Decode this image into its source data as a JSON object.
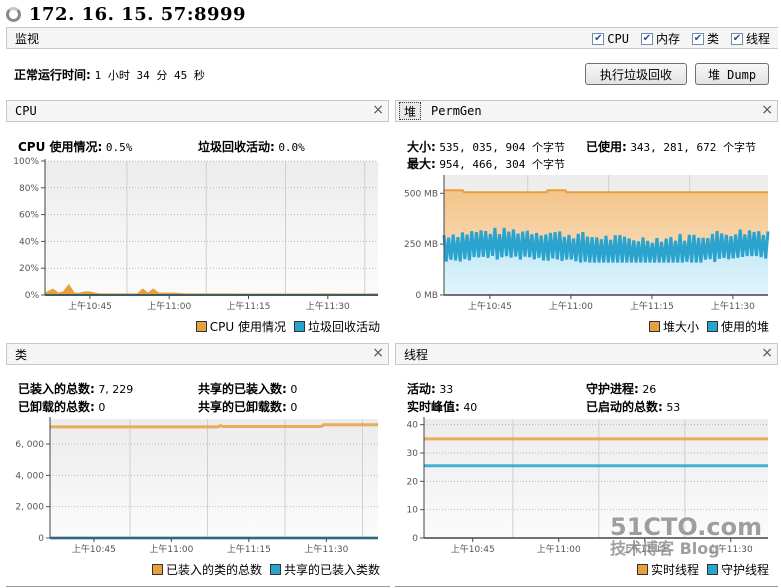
{
  "window": {
    "title": "172. 16. 15. 57:8999",
    "status_icon": "loading-spinner-icon"
  },
  "monitor_bar": {
    "label": "监视",
    "checkboxes": [
      {
        "label": "CPU",
        "checked": true
      },
      {
        "label": "内存",
        "checked": true
      },
      {
        "label": "类",
        "checked": true
      },
      {
        "label": "线程",
        "checked": true
      }
    ]
  },
  "uptime": {
    "label": "正常运行时间:",
    "value": "1 小时 34 分 45 秒"
  },
  "buttons": {
    "gc": "执行垃圾回收",
    "heap_dump": "堆 Dump"
  },
  "colors": {
    "orange": "#e8a03c",
    "blue": "#2aa3cf",
    "panel_bg": "#f5f5f5"
  },
  "cpu_panel": {
    "title": "CPU",
    "close": "×",
    "stats": [
      {
        "label": "CPU 使用情况:",
        "value": "0.5%"
      },
      {
        "label": "垃圾回收活动:",
        "value": "0.0%"
      }
    ],
    "legend": [
      "CPU 使用情况",
      "垃圾回收活动"
    ]
  },
  "memory_panel": {
    "tabs": [
      "堆",
      "PermGen"
    ],
    "active_tab": "堆",
    "close": "×",
    "stats": [
      {
        "label": "大小:",
        "value": "535, 035, 904 个字节"
      },
      {
        "label": "已使用:",
        "value": "343, 281, 672 个字节"
      },
      {
        "label": "最大:",
        "value": "954, 466, 304 个字节"
      }
    ],
    "legend": [
      "堆大小",
      "使用的堆"
    ]
  },
  "classes_panel": {
    "title": "类",
    "close": "×",
    "stats": [
      {
        "label": "已装入的总数:",
        "value": "7, 229"
      },
      {
        "label": "共享的已装入数:",
        "value": "0"
      },
      {
        "label": "已卸载的总数:",
        "value": "0"
      },
      {
        "label": "共享的已卸载数:",
        "value": "0"
      }
    ],
    "legend": [
      "已装入的类的总数",
      "共享的已装入类数"
    ]
  },
  "threads_panel": {
    "title": "线程",
    "close": "×",
    "stats": [
      {
        "label": "活动:",
        "value": "33"
      },
      {
        "label": "守护进程:",
        "value": "26"
      },
      {
        "label": "实时峰值:",
        "value": "40"
      },
      {
        "label": "已启动的总数:",
        "value": "53"
      }
    ],
    "legend": [
      "实时线程",
      "守护线程"
    ]
  },
  "watermark": {
    "main": "51CTO.com",
    "sub": "技术博客 Blog"
  },
  "chart_data": [
    {
      "id": "cpu",
      "type": "area",
      "title": "CPU",
      "x_ticks": [
        "上午10:45",
        "上午11:00",
        "上午11:15",
        "上午11:30"
      ],
      "x_range_minutes": [
        36.5,
        99.5
      ],
      "x_tick_minutes": [
        45,
        60,
        75,
        90
      ],
      "y_ticks": [
        "0%",
        "20%",
        "40%",
        "60%",
        "80%",
        "100%"
      ],
      "ylim": [
        0,
        100
      ],
      "grid": true,
      "legend": "bottom-right",
      "series": [
        {
          "name": "CPU 使用情况",
          "color": "#e8a03c",
          "x": [
            36.5,
            37,
            38,
            39,
            40,
            41,
            42,
            43,
            44,
            45,
            46,
            47,
            48,
            50,
            52,
            54,
            55,
            56,
            57,
            58,
            59,
            60,
            61,
            62,
            63,
            65,
            70,
            75,
            80,
            85,
            90,
            95,
            99.5
          ],
          "y": [
            0.5,
            2,
            4,
            1,
            2,
            7,
            1,
            1,
            2,
            2,
            1,
            0.5,
            0.5,
            0.5,
            0.5,
            0.5,
            4,
            1,
            4,
            1,
            1,
            1,
            1,
            0.8,
            0.5,
            0.5,
            0.5,
            0.4,
            0.4,
            0.4,
            0.5,
            0.4,
            0.5
          ]
        },
        {
          "name": "垃圾回收活动",
          "color": "#2aa3cf",
          "x": [
            36.5,
            99.5
          ],
          "y": [
            0,
            0
          ]
        }
      ]
    },
    {
      "id": "heap",
      "type": "area",
      "title": "堆",
      "x_ticks": [
        "上午10:45",
        "上午11:00",
        "上午11:15",
        "上午11:30"
      ],
      "x_range_minutes": [
        36.5,
        96.5
      ],
      "x_tick_minutes": [
        45,
        60,
        75,
        90
      ],
      "y_ticks": [
        "0 MB",
        "250 MB",
        "500 MB"
      ],
      "ylim": [
        0,
        590
      ],
      "grid": true,
      "legend": "bottom-right",
      "series": [
        {
          "name": "堆大小",
          "color": "#e8a03c",
          "x": [
            36.5,
            40,
            40.2,
            55.5,
            55.7,
            59,
            59.2,
            96.5
          ],
          "y": [
            515,
            515,
            505,
            505,
            515,
            515,
            505,
            505
          ]
        },
        {
          "name": "使用的堆",
          "color": "#2aa3cf",
          "y_min_approx": 160,
          "y_max_approx": 330,
          "pattern": "sawtooth",
          "current_mb": 327
        }
      ]
    },
    {
      "id": "classes",
      "type": "line",
      "title": "类",
      "x_ticks": [
        "上午10:45",
        "上午11:00",
        "上午11:15",
        "上午11:30"
      ],
      "x_range_minutes": [
        36.5,
        100
      ],
      "x_tick_minutes": [
        45,
        60,
        75,
        90
      ],
      "y_ticks": [
        "0",
        "2, 000",
        "4, 000",
        "6, 000"
      ],
      "ylim": [
        0,
        7600
      ],
      "grid": true,
      "legend": "bottom-right",
      "series": [
        {
          "name": "已装入的类的总数",
          "color": "#e8a03c",
          "x": [
            36.5,
            69,
            69.5,
            70,
            89,
            89.5,
            100
          ],
          "y": [
            7100,
            7100,
            7180,
            7120,
            7120,
            7229,
            7229
          ]
        },
        {
          "name": "共享的已装入类数",
          "color": "#2aa3cf",
          "x": [
            36.5,
            100
          ],
          "y": [
            0,
            0
          ]
        }
      ]
    },
    {
      "id": "threads",
      "type": "line",
      "title": "线程",
      "x_ticks": [
        "上午10:45",
        "上午11:00",
        "上午11:15",
        "上午11:30"
      ],
      "x_range_minutes": [
        36.5,
        96.5
      ],
      "x_tick_minutes": [
        45,
        60,
        75,
        90
      ],
      "y_ticks": [
        "0",
        "10",
        "20",
        "30",
        "40"
      ],
      "ylim": [
        0,
        42
      ],
      "grid": true,
      "legend": "bottom-right",
      "series": [
        {
          "name": "实时线程",
          "color": "#e8a03c",
          "x": [
            36.5,
            96.5
          ],
          "y": [
            35,
            35
          ]
        },
        {
          "name": "守护线程",
          "color": "#2aa3cf",
          "x": [
            36.5,
            96.5
          ],
          "y": [
            25.5,
            25.5
          ]
        }
      ]
    }
  ]
}
